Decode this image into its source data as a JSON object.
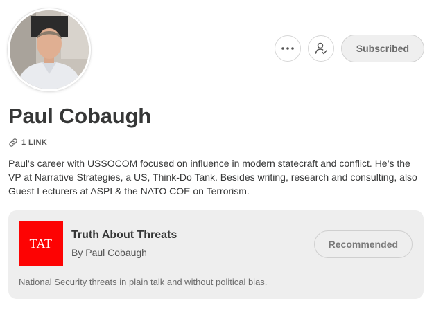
{
  "profile": {
    "name": "Paul Cobaugh",
    "links_label": "1 LINK",
    "bio": "Paul's career with USSOCOM focused on influence in modern statecraft and conflict. He’s the VP at Narrative Strategies, a US, Think-Do Tank. Besides writing, research and consulting, also Guest Lecturers at ASPI & the NATO COE on Terrorism."
  },
  "actions": {
    "more_icon": "ellipsis-icon",
    "follow_icon": "person-check-icon",
    "subscribed_label": "Subscribed"
  },
  "publication": {
    "logo_text": "TAT",
    "logo_color": "#fd0303",
    "title": "Truth About Threats",
    "author": "By Paul Cobaugh",
    "description": "National Security threats in plain talk and without political bias.",
    "recommended_label": "Recommended"
  }
}
